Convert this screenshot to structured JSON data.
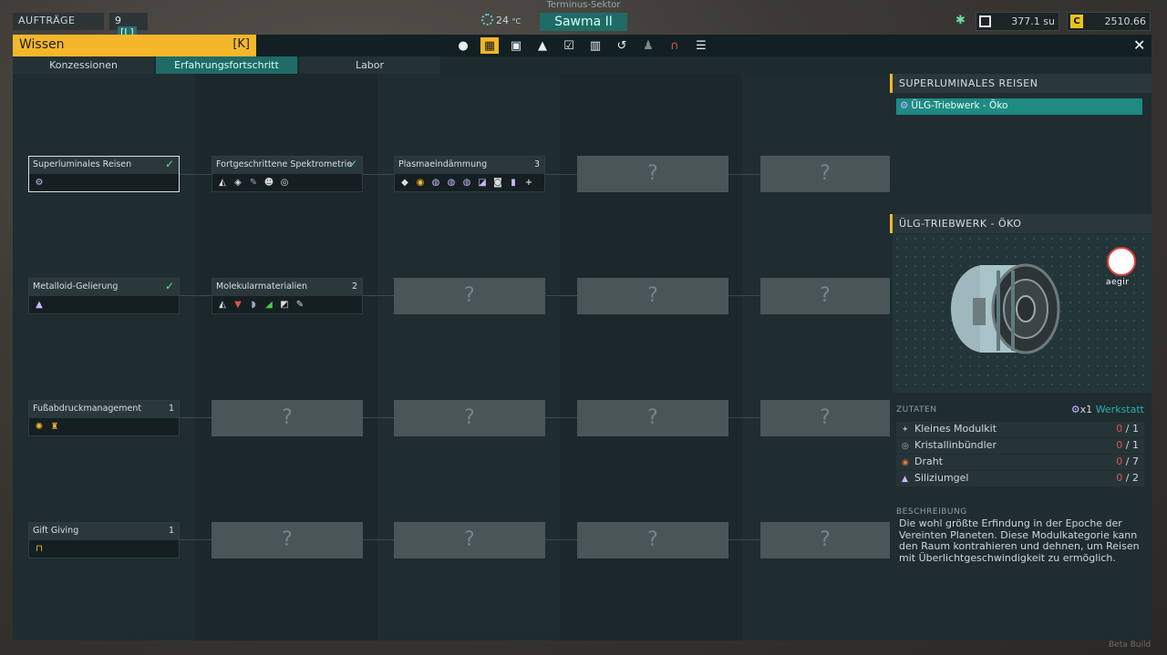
{
  "top": {
    "sector": "Terminus-Sektor",
    "auftraege_label": "AUFTRÄGE",
    "auftraege_count": "9",
    "auftraege_key": "[L]",
    "temperature": "24",
    "temp_unit": "°C",
    "planet": "Sawma II",
    "su_value": "377.1 su",
    "credits": "2510.66"
  },
  "window": {
    "title": "Wissen",
    "key": "[K]",
    "tabs": [
      "Konzessionen",
      "Erfahrungsfortschritt",
      "Labor"
    ],
    "active_tab": "Erfahrungsfortschritt",
    "nav_icons": [
      "person-icon",
      "tree-icon",
      "panel-icon",
      "ship-icon",
      "checkbox-icon",
      "book-icon",
      "history-icon",
      "crew-icon",
      "magnet-icon",
      "database-icon"
    ]
  },
  "tree": {
    "row1": {
      "n1": {
        "title": "Superluminales Reisen",
        "status": "✓"
      },
      "n2": {
        "title": "Fortgeschrittene Spektrometrie",
        "status": "✓"
      },
      "n3": {
        "title": "Plasmaeindämmung",
        "status": "3"
      }
    },
    "row2": {
      "n1": {
        "title": "Metalloid-Gelierung",
        "status": "✓"
      },
      "n2": {
        "title": "Molekularmaterialien",
        "status": "2"
      }
    },
    "row3": {
      "n1": {
        "title": "Fußabdruckmanagement",
        "status": "1"
      }
    },
    "row4": {
      "n1": {
        "title": "Gift Giving",
        "status": "1"
      }
    },
    "locked": "?"
  },
  "panel": {
    "section_title": "SUPERLUMINALES REISEN",
    "selected_item": "ÜLG-Triebwerk - Öko",
    "detail_title": "ÜLG-TRIEBWERK - ÖKO",
    "brand": "aegir",
    "ingredients_label": "ZUTATEN",
    "workshop_multiplier": "x1",
    "workshop": "Werkstatt",
    "ingredients": [
      {
        "name": "Kleines Modulkit",
        "have": "0",
        "need": "/ 1"
      },
      {
        "name": "Kristallinbündler",
        "have": "0",
        "need": "/ 1"
      },
      {
        "name": "Draht",
        "have": "0",
        "need": "/ 7"
      },
      {
        "name": "Siliziumgel",
        "have": "0",
        "need": "/ 2"
      }
    ],
    "description_label": "BESCHREIBUNG",
    "description": "Die wohl größte Erfindung in der Epoche der Vereinten Planeten. Diese Modulkategorie kann den Raum kontrahieren und dehnen, um Reisen mit Überlichtgeschwindigkeit zu ermöglich."
  },
  "footer": {
    "build": "Beta Build"
  }
}
